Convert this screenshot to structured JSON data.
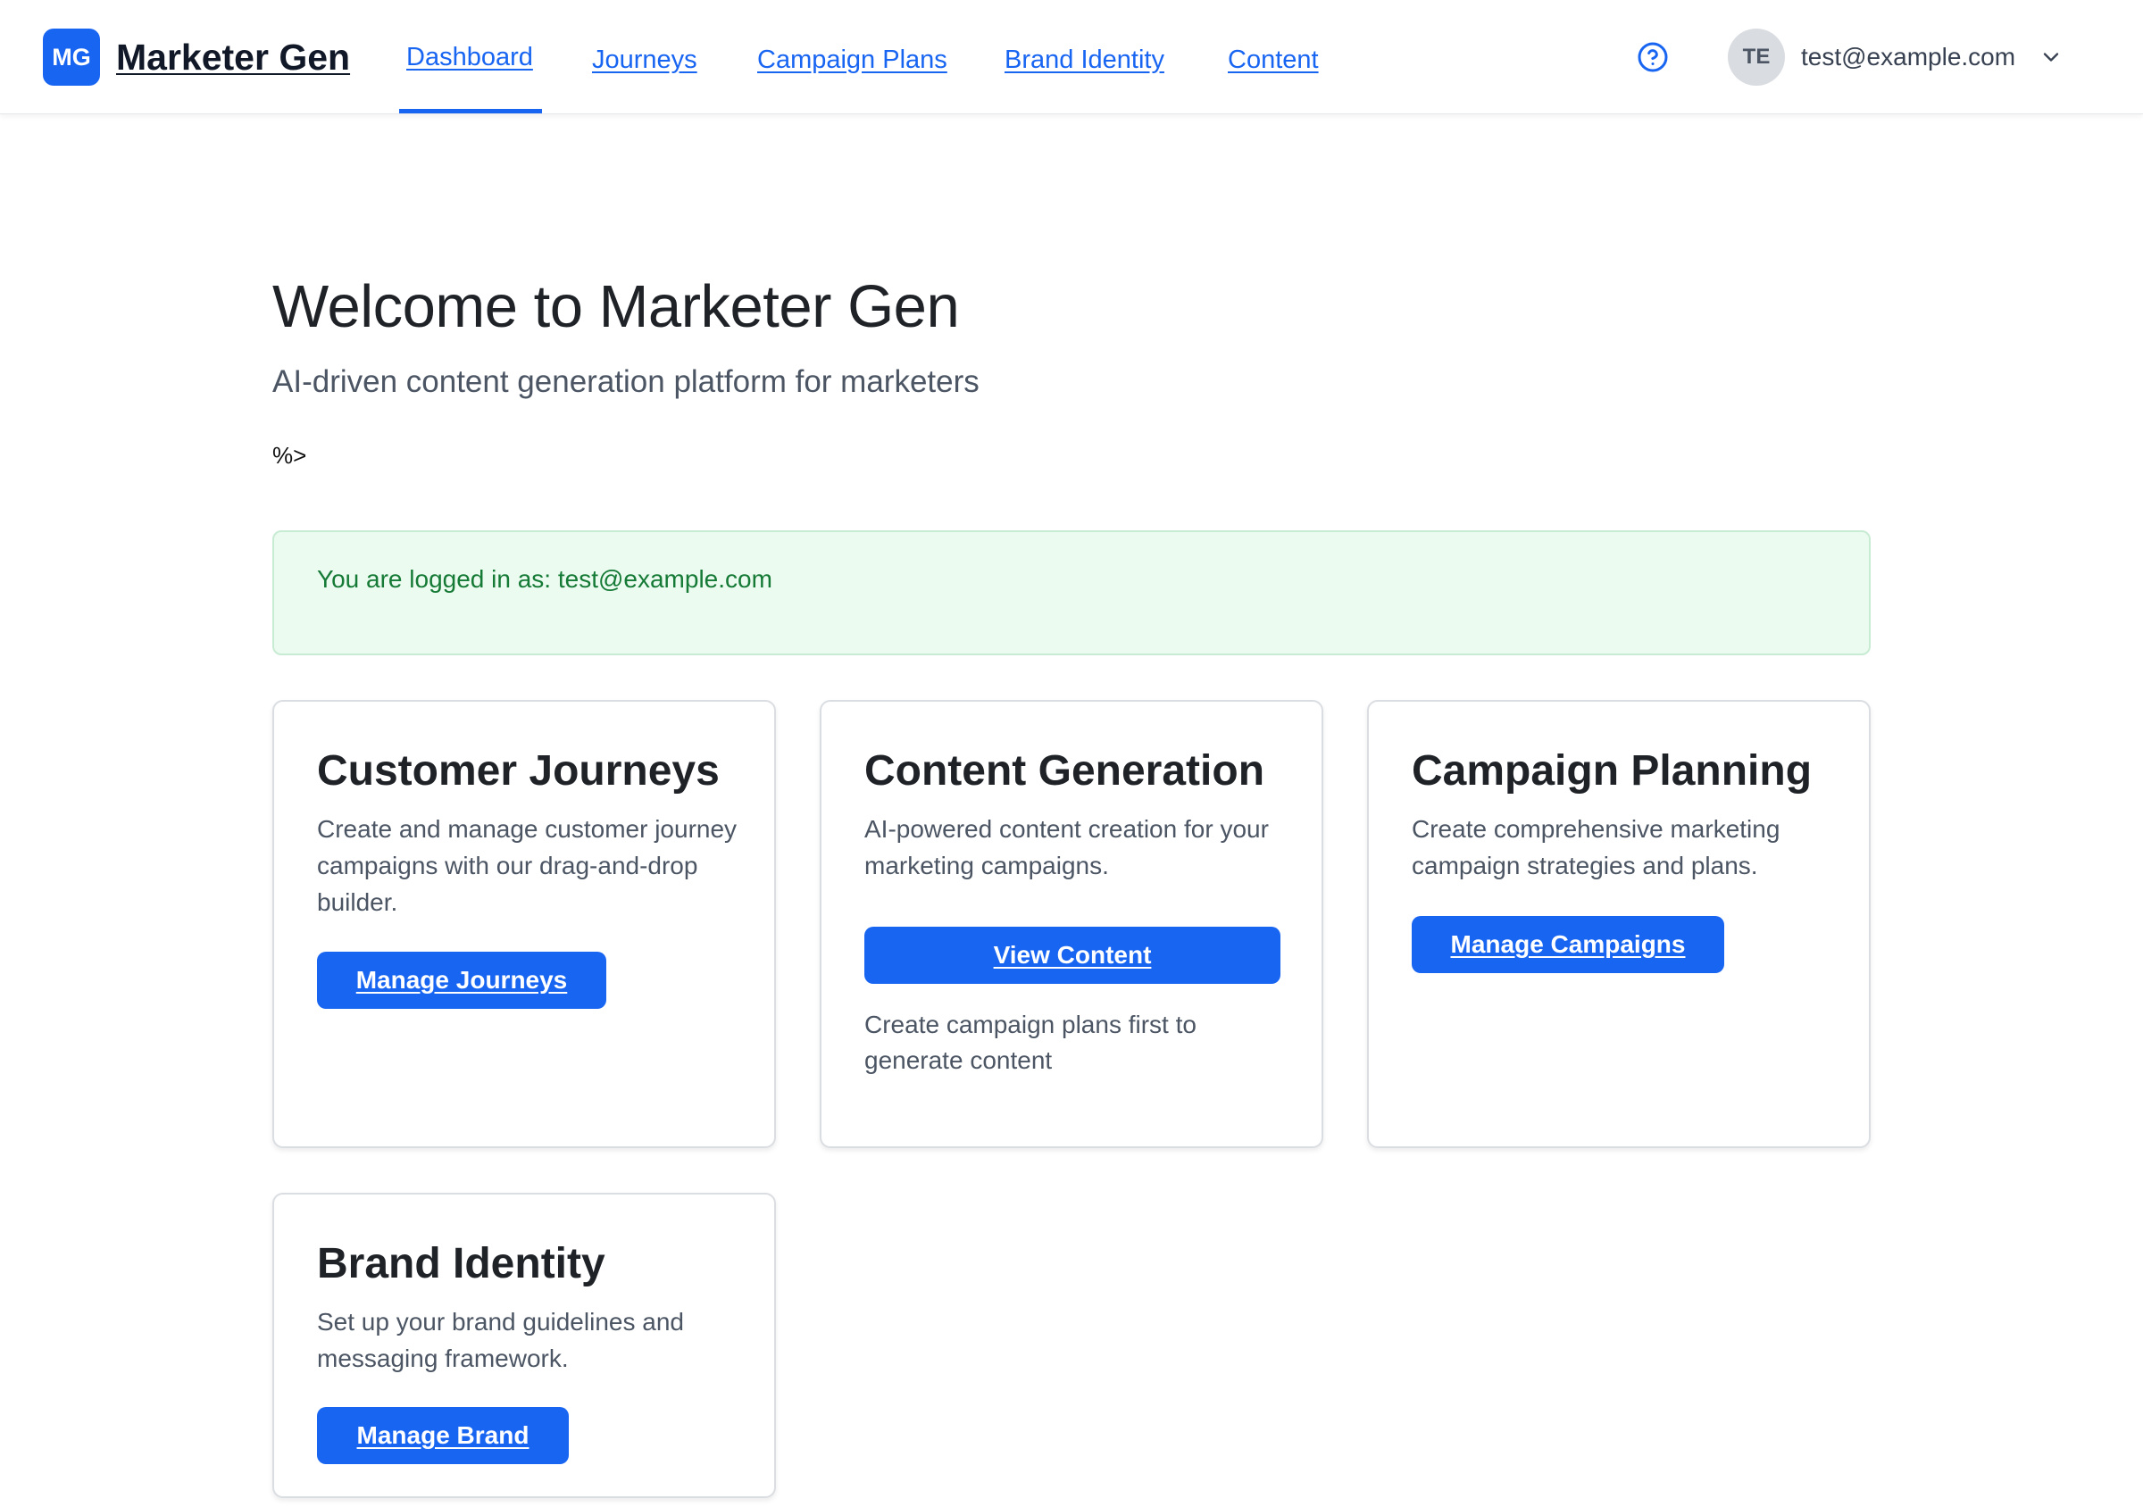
{
  "header": {
    "logo_text": "MG",
    "app_name": "Marketer Gen",
    "nav": [
      {
        "label": "Dashboard",
        "active": true
      },
      {
        "label": "Journeys"
      },
      {
        "label": "Campaign Plans"
      },
      {
        "label": "Brand Identity"
      },
      {
        "label": "Content"
      }
    ],
    "help_icon": "question-circle-icon",
    "user": {
      "initials": "TE",
      "email": "test@example.com",
      "menu_icon": "chevron-down-icon"
    }
  },
  "main": {
    "title": "Welcome to Marketer Gen",
    "subtitle": "AI-driven content generation platform for marketers",
    "stray_text": "%>",
    "alert": "You are logged in as: test@example.com",
    "cards": [
      {
        "title": "Customer Journeys",
        "description": "Create and manage customer journey campaigns with our drag-and-drop builder.",
        "button": "Manage Journeys"
      },
      {
        "title": "Content Generation",
        "description": "AI-powered content creation for your marketing campaigns.",
        "button": "View Content",
        "note": "Create campaign plans first to generate content"
      },
      {
        "title": "Campaign Planning",
        "description": "Create comprehensive marketing campaign strategies and plans.",
        "button": "Manage Campaigns"
      },
      {
        "title": "Brand Identity",
        "description": "Set up your brand guidelines and messaging framework.",
        "button": "Manage Brand"
      }
    ]
  },
  "colors": {
    "primary": "#1865f2",
    "success_bg": "#ecfbf0",
    "success_text": "#157a35"
  }
}
